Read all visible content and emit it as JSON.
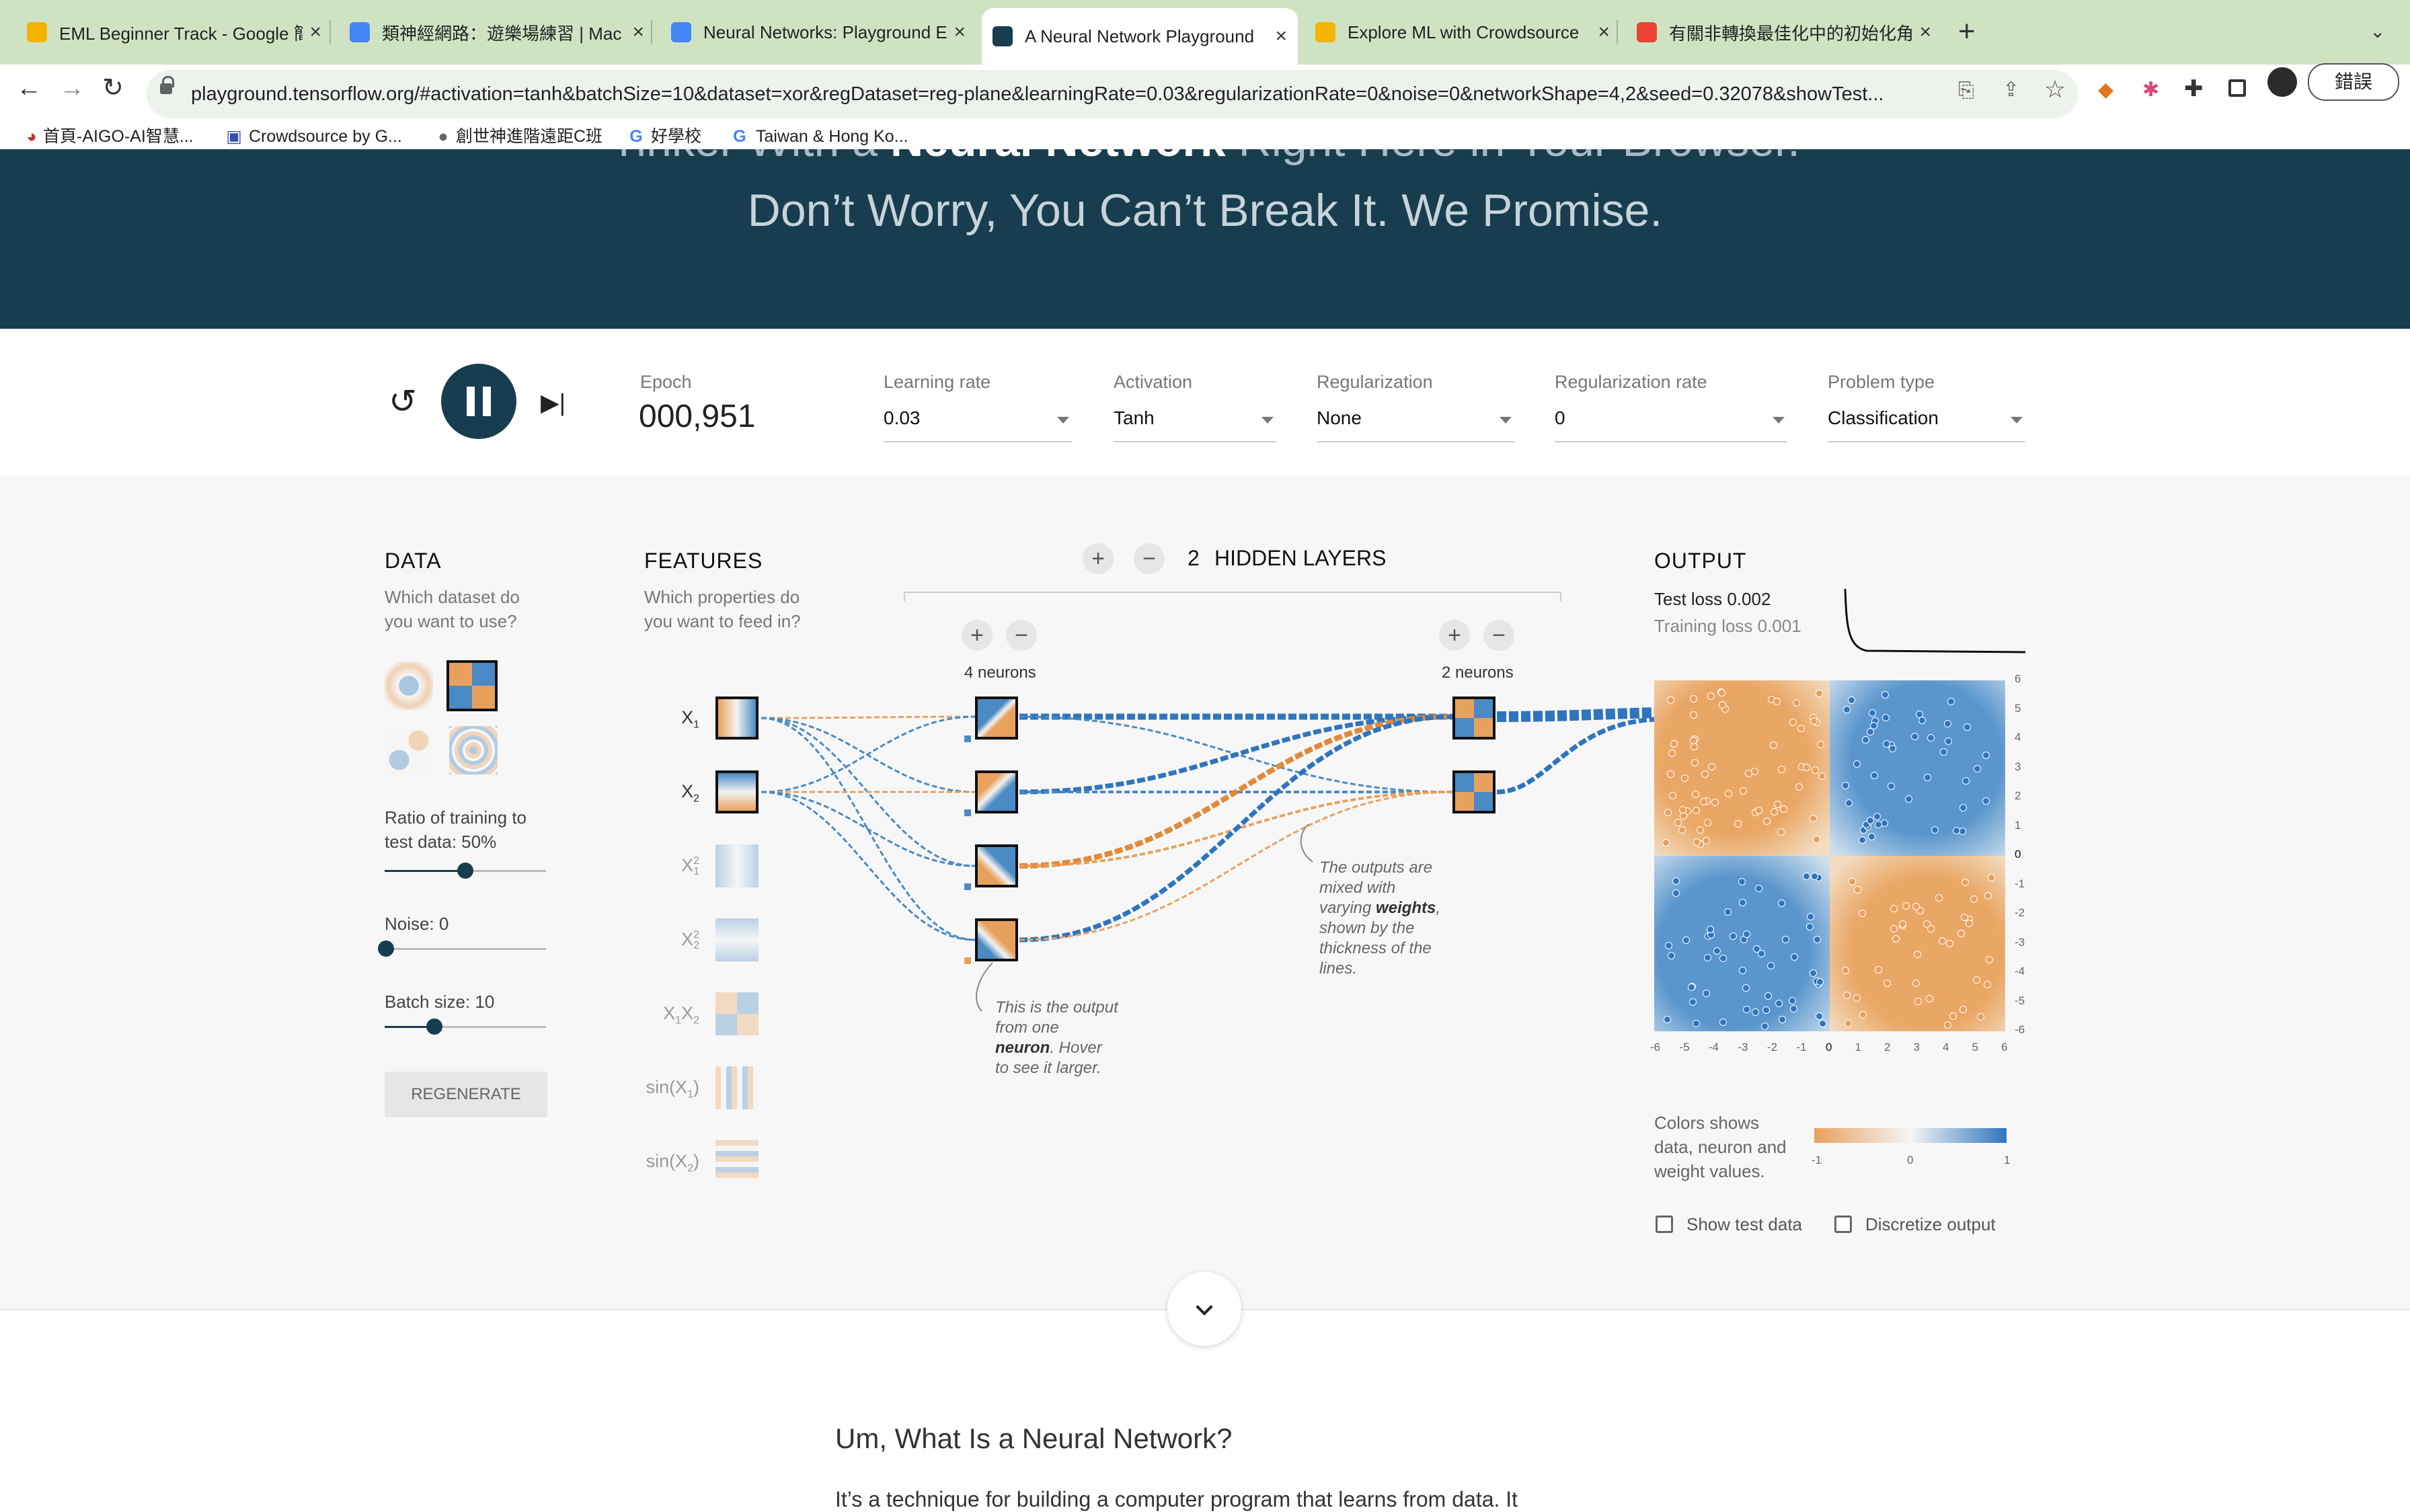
{
  "browser": {
    "tabs": [
      {
        "title": "EML Beginner Track - Google 簡",
        "favicon_color": "#f5b400"
      },
      {
        "title": "類神經網路：遊樂場練習 | Mac",
        "favicon_color": "#4285f4"
      },
      {
        "title": "Neural Networks: Playground E",
        "favicon_color": "#4285f4"
      },
      {
        "title": "A Neural Network Playground",
        "favicon_color": "#183d4e"
      },
      {
        "title": "Explore ML with Crowdsource",
        "favicon_color": "#f5b400"
      },
      {
        "title": "有關非轉換最佳化中的初始化角色",
        "favicon_color": "#ea4335"
      }
    ],
    "new_tab_label": "+",
    "url": "playground.tensorflow.org/#activation=tanh&batchSize=10&dataset=xor&regDataset=reg-plane&learningRate=0.03&regularizationRate=0&noise=0&networkShape=4,2&seed=0.32078&showTest...",
    "profile_button": "錯誤",
    "bookmarks": [
      "首頁-AIGO-AI智慧...",
      "Crowdsource by G...",
      "創世神進階遠距C班",
      "好學校",
      "Taiwan & Hong Ko..."
    ]
  },
  "hero": {
    "line1_prefix": "Tinker With a ",
    "line1_bold": "Neural Network",
    "line1_suffix": " Right Here in Your Browser.",
    "line2": "Don’t Worry, You Can’t Break It. We Promise."
  },
  "controls": {
    "epoch_label": "Epoch",
    "epoch_value": "000,951",
    "learning_rate_label": "Learning rate",
    "learning_rate_value": "0.03",
    "activation_label": "Activation",
    "activation_value": "Tanh",
    "regularization_label": "Regularization",
    "regularization_value": "None",
    "reg_rate_label": "Regularization rate",
    "reg_rate_value": "0",
    "problem_type_label": "Problem type",
    "problem_type_value": "Classification"
  },
  "data_panel": {
    "title": "DATA",
    "subtitle_1": "Which dataset do",
    "subtitle_2": "you want to use?",
    "ratio_label": "Ratio of training to",
    "ratio_label_2": "test data:  50%",
    "ratio_value": 0.5,
    "noise_label": "Noise:  0",
    "noise_value": 0,
    "batch_label": "Batch size:  10",
    "batch_value": 0.31,
    "regenerate": "REGENERATE"
  },
  "features_panel": {
    "title": "FEATURES",
    "subtitle_1": "Which properties do",
    "subtitle_2": "you want to feed in?",
    "features": [
      {
        "base": "X",
        "sub": "1",
        "sup": "",
        "active": true
      },
      {
        "base": "X",
        "sub": "2",
        "sup": "",
        "active": true
      },
      {
        "base": "X",
        "sub": "1",
        "sup": "2",
        "active": false
      },
      {
        "base": "X",
        "sub": "2",
        "sup": "2",
        "active": false
      },
      {
        "base": "X",
        "sub": "1",
        "sup": "",
        "tail": "X",
        "sub2": "2",
        "active": false
      },
      {
        "base": "sin(X",
        "sub": "1",
        "tail": ")",
        "active": false
      },
      {
        "base": "sin(X",
        "sub": "2",
        "tail": ")",
        "active": false
      }
    ]
  },
  "network": {
    "hidden_layers_count": "2",
    "hidden_layers_label": "HIDDEN LAYERS",
    "layer1_label": "4 neurons",
    "layer2_label": "2 neurons",
    "note_neuron": [
      "This is the output",
      "from one",
      "neuron. Hover",
      "to see it larger."
    ],
    "note_neuron_bold": "neuron",
    "note_weights": [
      "The outputs are",
      "mixed with",
      "varying weights,",
      "shown by the",
      "thickness of the",
      "lines."
    ],
    "note_weights_bold": "weights"
  },
  "output_panel": {
    "title": "OUTPUT",
    "test_loss": "Test loss 0.002",
    "training_loss": "Training loss 0.001",
    "x_ticks": [
      "-6",
      "-5",
      "-4",
      "-3",
      "-2",
      "-1",
      "0",
      "1",
      "2",
      "3",
      "4",
      "5",
      "6"
    ],
    "y_ticks": [
      "6",
      "5",
      "4",
      "3",
      "2",
      "1",
      "0",
      "-1",
      "-2",
      "-3",
      "-4",
      "-5",
      "-6"
    ],
    "legend_text_1": "Colors shows",
    "legend_text_2": "data, neuron and",
    "legend_text_3": "weight values.",
    "legend_ticks": [
      "-1",
      "0",
      "1"
    ],
    "show_test_data": "Show test data",
    "discretize_output": "Discretize output",
    "color_negative": "#e8a15d",
    "color_positive": "#4a8ac4"
  },
  "article": {
    "heading": "Um, What Is a Neural Network?",
    "first_line": "It’s a technique for building a computer program that learns from data. It"
  }
}
